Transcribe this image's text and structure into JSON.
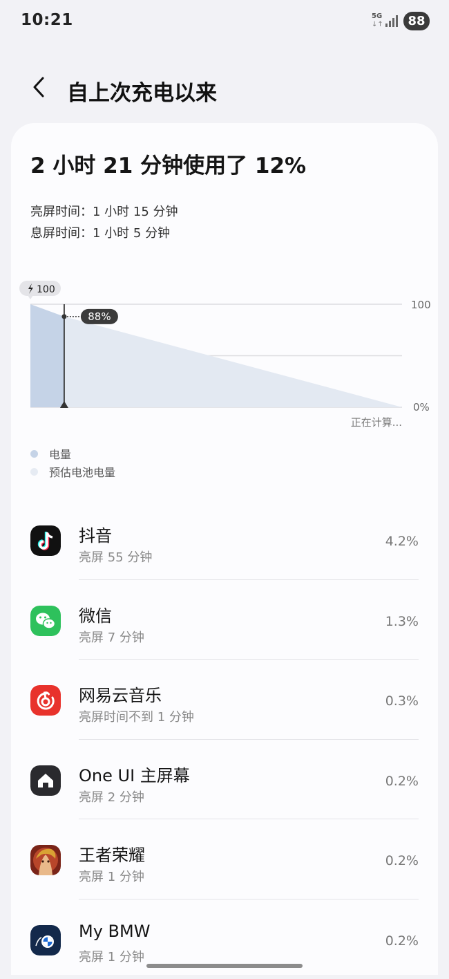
{
  "status_bar": {
    "time": "10:21",
    "network": "5G",
    "network_arrows": "↓↑",
    "battery_level": "88",
    "signal_icon": "signal-icon"
  },
  "header": {
    "title": "自上次充电以来",
    "back_icon": "back-arrow-icon"
  },
  "summary": {
    "title": "2 小时 21 分钟使用了 12%",
    "screen_on": "亮屏时间：1 小时 15 分钟",
    "screen_off": "息屏时间：1 小时 5 分钟"
  },
  "chart_data": {
    "type": "area",
    "start_badge": "100",
    "marker_label": "88%",
    "marker_value": 88,
    "y_tick_top": "100",
    "y_tick_bottom": "0%",
    "ylim": [
      0,
      100
    ],
    "status_text": "正在计算...",
    "series": [
      {
        "name": "电量",
        "color": "#c5d3e7",
        "points": [
          [
            0,
            100
          ],
          [
            1,
            88
          ]
        ]
      },
      {
        "name": "预估电池电量",
        "color": "#e3e9f2",
        "points": [
          [
            1,
            88
          ],
          [
            11,
            0
          ]
        ]
      }
    ],
    "legend": [
      "电量",
      "预估电池电量"
    ]
  },
  "apps": [
    {
      "name": "抖音",
      "sub": "亮屏 55 分钟",
      "percent": "4.2%",
      "icon": "douyin-icon"
    },
    {
      "name": "微信",
      "sub": "亮屏 7 分钟",
      "percent": "1.3%",
      "icon": "wechat-icon"
    },
    {
      "name": "网易云音乐",
      "sub": "亮屏时间不到 1 分钟",
      "percent": "0.3%",
      "icon": "netease-music-icon"
    },
    {
      "name": "One UI 主屏幕",
      "sub": "亮屏 2 分钟",
      "percent": "0.2%",
      "icon": "home-icon"
    },
    {
      "name": "王者荣耀",
      "sub": "亮屏 1 分钟",
      "percent": "0.2%",
      "icon": "honor-of-kings-icon"
    },
    {
      "name": "My BMW",
      "sub": "亮屏 1 分钟",
      "percent": "0.2%",
      "icon": "bmw-icon"
    }
  ],
  "colors": {
    "background": "#f2f2f6",
    "card": "#fcfcfe",
    "douyin": "#111111",
    "wechat": "#2ec15c",
    "netease": "#e8322c",
    "home": "#2a2a2e",
    "bmw": "#13294b"
  }
}
